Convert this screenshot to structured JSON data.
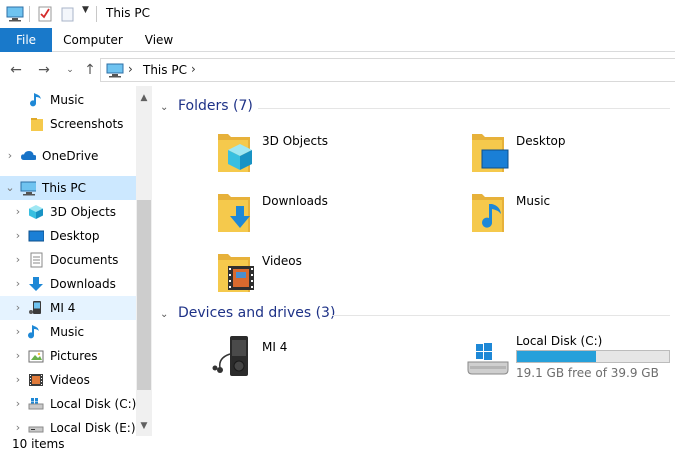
{
  "window": {
    "title": "This PC"
  },
  "ribbon": {
    "tabs": [
      {
        "label": "File"
      },
      {
        "label": "Computer"
      },
      {
        "label": "View"
      }
    ]
  },
  "address": {
    "crumbs": [
      "This PC"
    ]
  },
  "sidebar": {
    "items": [
      {
        "label": "Music",
        "icon": "music-note-icon",
        "state": "normal"
      },
      {
        "label": "Screenshots",
        "icon": "folder-icon",
        "state": "normal"
      },
      {
        "label": "OneDrive",
        "icon": "cloud-icon",
        "state": "normal"
      },
      {
        "label": "This PC",
        "icon": "computer-icon",
        "state": "selected"
      },
      {
        "label": "3D Objects",
        "icon": "cube-icon",
        "state": "normal"
      },
      {
        "label": "Desktop",
        "icon": "desktop-icon",
        "state": "normal"
      },
      {
        "label": "Documents",
        "icon": "document-icon",
        "state": "normal"
      },
      {
        "label": "Downloads",
        "icon": "download-arrow-icon",
        "state": "normal"
      },
      {
        "label": "MI 4",
        "icon": "phone-icon",
        "state": "hover"
      },
      {
        "label": "Music",
        "icon": "music-note-icon",
        "state": "normal"
      },
      {
        "label": "Pictures",
        "icon": "picture-icon",
        "state": "normal"
      },
      {
        "label": "Videos",
        "icon": "film-icon",
        "state": "normal"
      },
      {
        "label": "Local Disk (C:)",
        "icon": "drive-icon",
        "state": "normal"
      },
      {
        "label": "Local Disk (E:)",
        "icon": "drive-icon",
        "state": "normal"
      }
    ]
  },
  "main": {
    "folders_header": "Folders (7)",
    "folders": [
      {
        "label": "3D Objects",
        "icon": "folder-3d-objects-icon"
      },
      {
        "label": "Desktop",
        "icon": "folder-desktop-icon"
      },
      {
        "label": "Downloads",
        "icon": "folder-downloads-icon"
      },
      {
        "label": "Music",
        "icon": "folder-music-icon"
      },
      {
        "label": "Videos",
        "icon": "folder-videos-icon"
      }
    ],
    "devices_header": "Devices and drives (3)",
    "devices": [
      {
        "label": "MI 4",
        "icon": "media-player-icon"
      },
      {
        "label": "Local Disk (C:)",
        "icon": "windows-drive-icon",
        "free_text": "19.1 GB free of 39.9 GB",
        "used_fraction": 0.52
      }
    ]
  },
  "status": {
    "text": "10 items"
  },
  "colors": {
    "accent": "#1979ca",
    "header_text": "#1e3287",
    "selected_bg": "#cce8ff",
    "drive_fill": "#26a0da",
    "folder": "#f5c94c"
  }
}
